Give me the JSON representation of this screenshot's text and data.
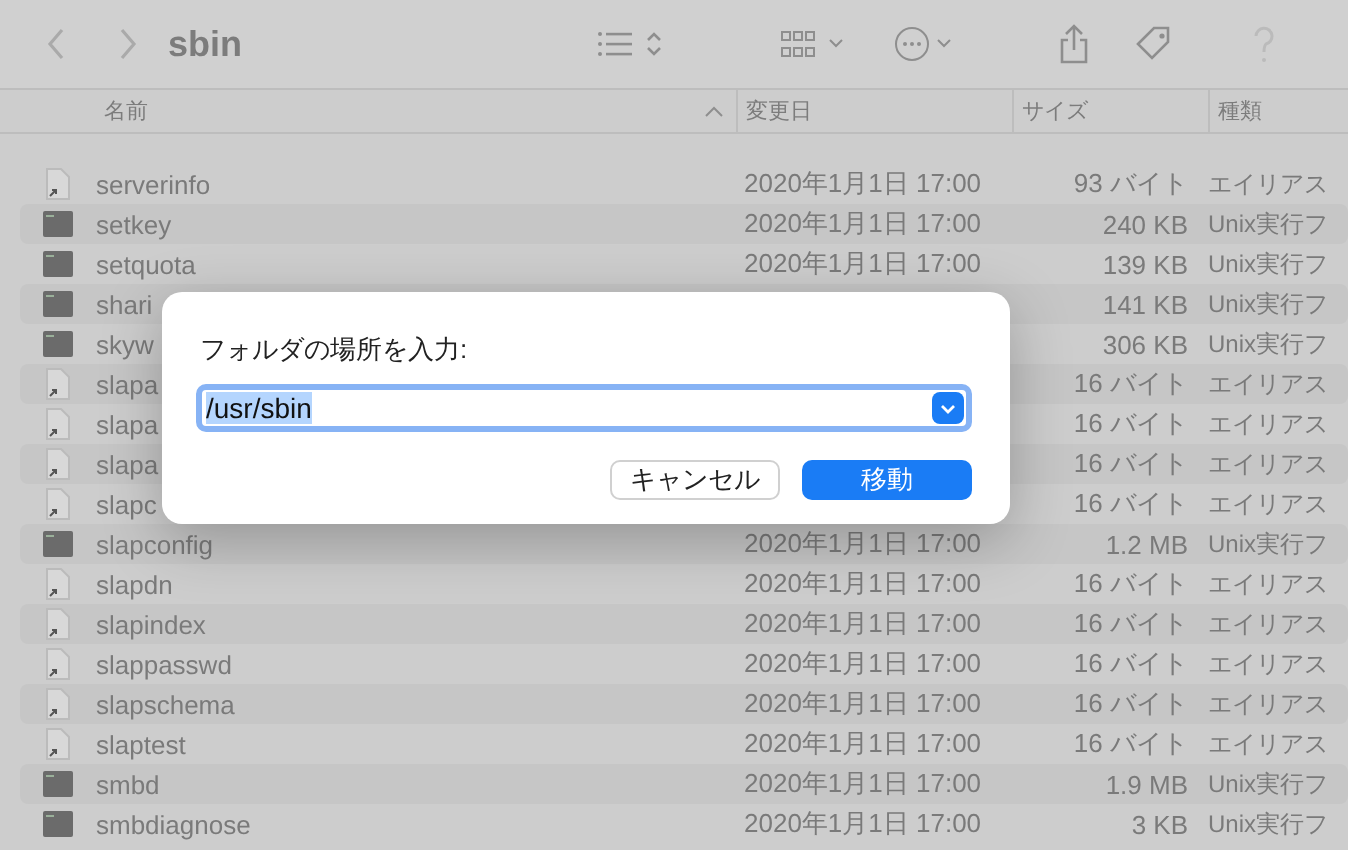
{
  "window": {
    "title": "sbin"
  },
  "columns": [
    {
      "label": "名前",
      "sorted": true
    },
    {
      "label": "変更日",
      "sorted": false
    },
    {
      "label": "サイズ",
      "sorted": false
    },
    {
      "label": "種類",
      "sorted": false
    }
  ],
  "rows": [
    {
      "kind": "alias",
      "name": "serverinfo",
      "date": "2020年1月1日 17:00",
      "size": "93 バイト",
      "type": "エイリアス"
    },
    {
      "kind": "exec",
      "name": "setkey",
      "date": "2020年1月1日 17:00",
      "size": "240 KB",
      "type": "Unix実行フ"
    },
    {
      "kind": "exec",
      "name": "setquota",
      "date": "2020年1月1日 17:00",
      "size": "139 KB",
      "type": "Unix実行フ"
    },
    {
      "kind": "exec",
      "name": "shari",
      "size": "141 KB",
      "type": "Unix実行フ"
    },
    {
      "kind": "exec",
      "name": "skyw",
      "size": "306 KB",
      "type": "Unix実行フ"
    },
    {
      "kind": "alias",
      "name": "slapa",
      "size": "16 バイト",
      "type": "エイリアス"
    },
    {
      "kind": "alias",
      "name": "slapa",
      "size": "16 バイト",
      "type": "エイリアス"
    },
    {
      "kind": "alias",
      "name": "slapa",
      "size": "16 バイト",
      "type": "エイリアス"
    },
    {
      "kind": "alias",
      "name": "slapc",
      "size": "16 バイト",
      "type": "エイリアス"
    },
    {
      "kind": "exec",
      "name": "slapconfig",
      "date": "2020年1月1日 17:00",
      "size": "1.2 MB",
      "type": "Unix実行フ"
    },
    {
      "kind": "alias",
      "name": "slapdn",
      "date": "2020年1月1日 17:00",
      "size": "16 バイト",
      "type": "エイリアス"
    },
    {
      "kind": "alias",
      "name": "slapindex",
      "date": "2020年1月1日 17:00",
      "size": "16 バイト",
      "type": "エイリアス"
    },
    {
      "kind": "alias",
      "name": "slappasswd",
      "date": "2020年1月1日 17:00",
      "size": "16 バイト",
      "type": "エイリアス"
    },
    {
      "kind": "alias",
      "name": "slapschema",
      "date": "2020年1月1日 17:00",
      "size": "16 バイト",
      "type": "エイリアス"
    },
    {
      "kind": "alias",
      "name": "slaptest",
      "date": "2020年1月1日 17:00",
      "size": "16 バイト",
      "type": "エイリアス"
    },
    {
      "kind": "exec",
      "name": "smbd",
      "date": "2020年1月1日 17:00",
      "size": "1.9 MB",
      "type": "Unix実行フ"
    },
    {
      "kind": "exec",
      "name": "smbdiagnose",
      "date": "2020年1月1日 17:00",
      "size": "3 KB",
      "type": "Unix実行フ"
    }
  ],
  "dialog": {
    "label": "フォルダの場所を入力:",
    "value": "/usr/sbin",
    "value_selected": true,
    "buttons": [
      {
        "label": "キャンセル",
        "kind": "secondary"
      },
      {
        "label": "移動",
        "kind": "primary"
      }
    ]
  }
}
